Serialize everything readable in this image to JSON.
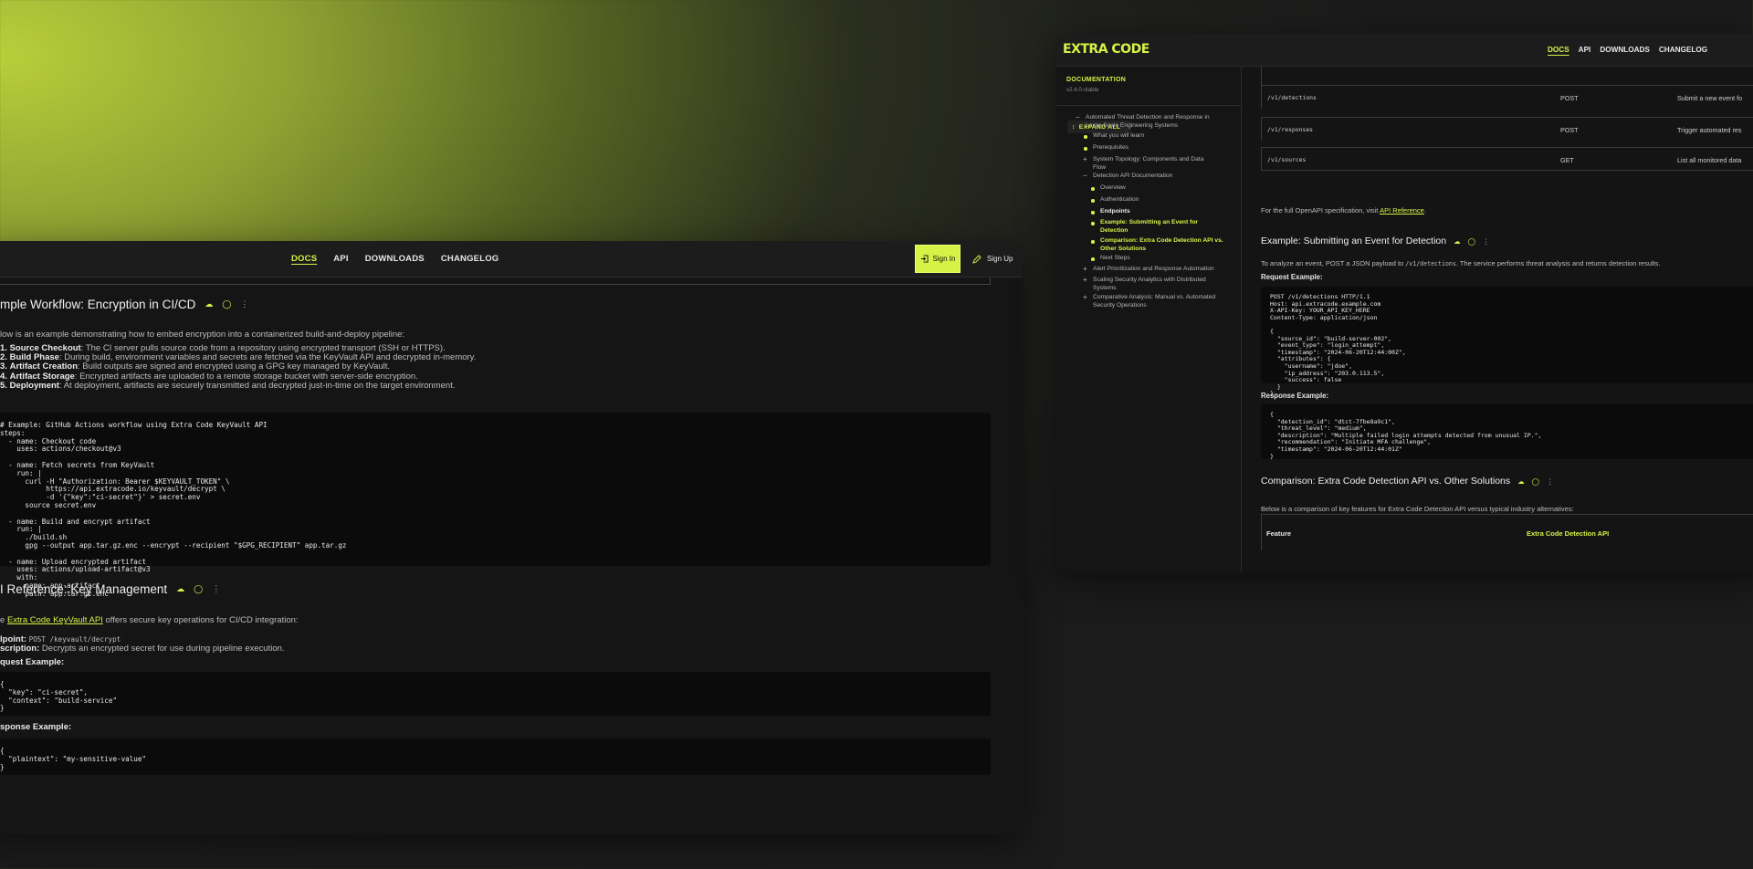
{
  "left_window": {
    "nav": [
      "DOCS",
      "API",
      "DOWNLOADS",
      "CHANGELOG"
    ],
    "sign_in": "Sign In",
    "sign_up": "Sign Up",
    "section1": {
      "heading": "mple Workflow: Encryption in CI/CD",
      "intro": "low is an example demonstrating how to embed encryption into a containerized build-and-deploy pipeline:",
      "steps": [
        {
          "num": "1.",
          "title": "Source Checkout",
          "text": ": The CI server pulls source code from a repository using encrypted transport (SSH or HTTPS)."
        },
        {
          "num": "2.",
          "title": "Build Phase",
          "text": ": During build, environment variables and secrets are fetched via the KeyVault API and decrypted in-memory."
        },
        {
          "num": "3.",
          "title": "Artifact Creation",
          "text": ": Build outputs are signed and encrypted using a GPG key managed by KeyVault."
        },
        {
          "num": "4.",
          "title": "Artifact Storage",
          "text": ": Encrypted artifacts are uploaded to a remote storage bucket with server-side encryption."
        },
        {
          "num": "5.",
          "title": "Deployment",
          "text": ": At deployment, artifacts are securely transmitted and decrypted just-in-time on the target environment."
        }
      ],
      "code": "# Example: GitHub Actions workflow using Extra Code KeyVault API\nsteps:\n  - name: Checkout code\n    uses: actions/checkout@v3\n\n  - name: Fetch secrets from KeyVault\n    run: |\n      curl -H \"Authorization: Bearer $KEYVAULT_TOKEN\" \\\n           https://api.extracode.io/keyvault/decrypt \\\n           -d '{\"key\":\"ci-secret\"}' > secret.env\n      source secret.env\n\n  - name: Build and encrypt artifact\n    run: |\n      ./build.sh\n      gpg --output app.tar.gz.enc --encrypt --recipient \"$GPG_RECIPIENT\" app.tar.gz\n\n  - name: Upload encrypted artifact\n    uses: actions/upload-artifact@v3\n    with:\n      name: app-artifact\n      path: app.tar.gz.enc"
    },
    "section2": {
      "heading": "I Reference: Key Management",
      "intro_pre": "e ",
      "intro_link": "Extra Code KeyVault API",
      "intro_post": " offers secure key operations for CI/CD integration:",
      "endpoint_label": "lpoint:",
      "endpoint_value": "POST /keyvault/decrypt",
      "desc_label": "scription:",
      "desc_value": " Decrypts an encrypted secret for use during pipeline execution.",
      "request_label": "quest Example:",
      "request_code": "{\n  \"key\": \"ci-secret\",\n  \"context\": \"build-service\"\n}",
      "response_label": "sponse Example:",
      "response_code": "{\n  \"plaintext\": \"my-sensitive-value\"\n}"
    }
  },
  "right_window": {
    "logo": "EXTRA CODE",
    "nav": [
      "DOCS",
      "API",
      "DOWNLOADS",
      "CHANGELOG"
    ],
    "sidebar": {
      "title": "DOCUMENTATION",
      "version": "v2.4.0-stable",
      "expand_all": "EXPAND ALL",
      "items": [
        {
          "label": "Automated Threat Detection and Response in",
          "label2": "Large-Scale Engineering Systems",
          "marker": "minus"
        },
        {
          "label": "What you will learn",
          "marker": "bullet"
        },
        {
          "label": "Prerequisites",
          "marker": "bullet"
        },
        {
          "label": "System Topology: Components and Data",
          "label2": "Flow",
          "marker": "plus"
        },
        {
          "label": "Detection API Documentation",
          "marker": "minus"
        },
        {
          "label": "Overview",
          "marker": "bullet"
        },
        {
          "label": "Authentication",
          "marker": "bullet"
        },
        {
          "label": "Endpoints",
          "marker": "bullet",
          "state": "bold"
        },
        {
          "label": "Example: Submitting an Event for",
          "label2": "Detection",
          "marker": "bullet",
          "state": "active"
        },
        {
          "label": "Comparison: Extra Code Detection API vs.",
          "label2": "Other Solutions",
          "marker": "bullet",
          "state": "active"
        },
        {
          "label": "Next Steps",
          "marker": "bullet"
        },
        {
          "label": "Alert Prioritization and Response Automation",
          "marker": "plus"
        },
        {
          "label": "Scaling Security Analytics with Distributed",
          "label2": "Systems",
          "marker": "plus"
        },
        {
          "label": "Comparative Analysis: Manual vs. Automated",
          "label2": "Security Operations",
          "marker": "plus"
        }
      ]
    },
    "endpoints": [
      {
        "path": "/v1/detections",
        "method": "POST",
        "desc": "Submit a new event fo"
      },
      {
        "path": "/v1/responses",
        "method": "POST",
        "desc": "Trigger automated res"
      },
      {
        "path": "/v1/sources",
        "method": "GET",
        "desc": "List all monitored data"
      }
    ],
    "openapi_pre": "For the full OpenAPI specification, visit ",
    "openapi_link": "API Reference",
    "openapi_post": ".",
    "example": {
      "heading": "Example: Submitting an Event for Detection",
      "intro_pre": "To analyze an event, POST a JSON payload to ",
      "intro_code": "/v1/detections",
      "intro_post": ". The service performs threat analysis and returns detection results.",
      "request_label": "Request Example:",
      "request_code": "POST /v1/detections HTTP/1.1\nHost: api.extracode.example.com\nX-API-Key: YOUR_API_KEY_HERE\nContent-Type: application/json\n\n{\n  \"source_id\": \"build-server-002\",\n  \"event_type\": \"login_attempt\",\n  \"timestamp\": \"2024-06-20T12:44:00Z\",\n  \"attributes\": {\n    \"username\": \"jdoe\",\n    \"ip_address\": \"203.0.113.5\",\n    \"success\": false\n  }\n}",
      "response_label": "Response Example:",
      "response_code": "{\n  \"detection_id\": \"dtct-7fbe8a9c1\",\n  \"threat_level\": \"medium\",\n  \"description\": \"Multiple failed login attempts detected from unusual IP.\",\n  \"recommendation\": \"Initiate MFA challenge\",\n  \"timestamp\": \"2024-06-20T12:44:01Z\"\n}"
    },
    "comparison": {
      "heading": "Comparison: Extra Code Detection API vs. Other Solutions",
      "intro": "Below is a comparison of key features for Extra Code Detection API versus typical industry alternatives:",
      "col1": "Feature",
      "col2": "Extra Code Detection API"
    }
  }
}
